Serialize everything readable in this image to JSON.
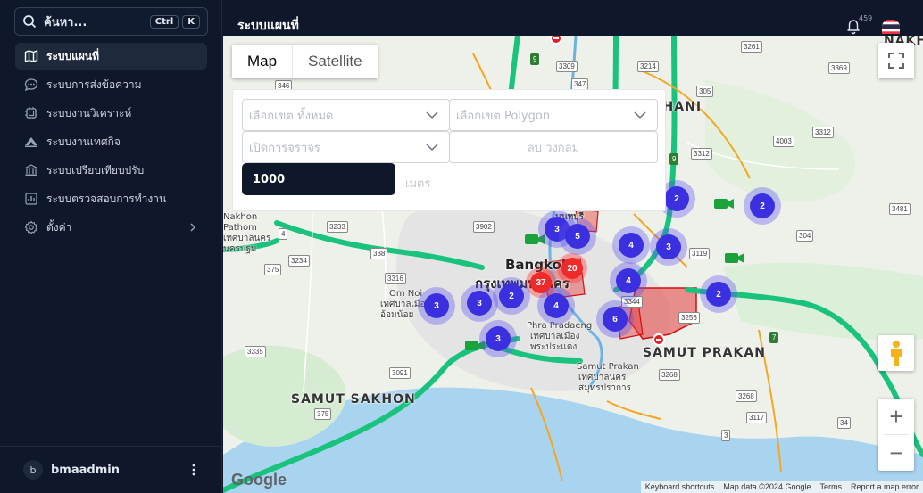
{
  "sidebar": {
    "search": {
      "placeholder": "ค้นหา...",
      "key1": "Ctrl",
      "key2": "K"
    },
    "items": [
      {
        "label": "ระบบแผนที่",
        "icon": "map-icon"
      },
      {
        "label": "ระบบการส่งข้อความ",
        "icon": "chat-icon"
      },
      {
        "label": "ระบบงานวิเคราะห์",
        "icon": "chip-icon"
      },
      {
        "label": "ระบบงานเทศกิจ",
        "icon": "officer-icon"
      },
      {
        "label": "ระบบเปรียบเทียบปรับ",
        "icon": "building-icon"
      },
      {
        "label": "ระบบตรวจสอบการทำงาน",
        "icon": "bar-chart-icon"
      },
      {
        "label": "ตั้งค่า",
        "icon": "gear-icon"
      }
    ],
    "user": {
      "initial": "b",
      "name": "bmaadmin"
    }
  },
  "header": {
    "title": "ระบบแผนที่",
    "notification_count": "459"
  },
  "map": {
    "type_control": {
      "map": "Map",
      "satellite": "Satellite"
    },
    "filters": {
      "district": "เลือกเขต ทั้งหมด",
      "polygon": "เลือกเขต Polygon",
      "traffic": "เปิดการจราจร",
      "clear_circle": "ลบ วงกลม",
      "radius_value": "1000",
      "radius_unit": "เมตร"
    },
    "labels": {
      "thani": "THANI",
      "nakhon_pathom": "Nakhon\nPathom",
      "nakhon_pathom_th": "เทศบาลนคร\nนครปฐม",
      "nonthaburi": "นนทบุรี",
      "bangkok": "Bangkok",
      "bangkok_th": "กรุงเทพมหานคร",
      "om_noi": "Om Noi",
      "om_noi_th": "เทศบาลเมือง\nอ้อมน้อย",
      "phra_pradaeng": "Phra Pradaeng",
      "phra_pradaeng_th": "เทศบาลเมือง\nพระประแดง",
      "samut_prakan": "SAMUT PRAKAN",
      "samut_prakan_city": "Samut Prakan",
      "samut_prakan_th": "เทศบาลนคร\nสมุทรปราการ",
      "samut_sakhon": "SAMUT SAKHON",
      "nakho": "NAKHO"
    },
    "route_shields": [
      "3309",
      "3214",
      "346",
      "347",
      "305",
      "3261",
      "3369",
      "3312",
      "4003",
      "3312",
      "3481",
      "304",
      "3119",
      "4",
      "3233",
      "3902",
      "3234",
      "338",
      "375",
      "3316",
      "3256",
      "3344",
      "7",
      "3335",
      "3091",
      "3268",
      "3268",
      "3117",
      "375",
      "3",
      "34",
      "9",
      "9"
    ],
    "clusters": [
      {
        "count": "3",
        "color": "blue"
      },
      {
        "count": "5",
        "color": "blue"
      },
      {
        "count": "2",
        "color": "blue"
      },
      {
        "count": "4",
        "color": "blue"
      },
      {
        "count": "3",
        "color": "blue"
      },
      {
        "count": "2",
        "color": "blue"
      },
      {
        "count": "20",
        "color": "red"
      },
      {
        "count": "37",
        "color": "red"
      },
      {
        "count": "4",
        "color": "blue"
      },
      {
        "count": "2",
        "color": "blue"
      },
      {
        "count": "2",
        "color": "blue"
      },
      {
        "count": "3",
        "color": "blue"
      },
      {
        "count": "3",
        "color": "blue"
      },
      {
        "count": "4",
        "color": "blue"
      },
      {
        "count": "6",
        "color": "blue"
      },
      {
        "count": "3",
        "color": "blue"
      }
    ],
    "attribution": {
      "shortcuts": "Keyboard shortcuts",
      "data": "Map data ©2024 Google",
      "terms": "Terms",
      "report": "Report a map error"
    },
    "logo": "Google"
  },
  "colors": {
    "sidebar_bg": "#0f172a",
    "cluster_blue": "#3b30e0",
    "cluster_red": "#ee2a2a",
    "highway_green": "#19c37d"
  }
}
